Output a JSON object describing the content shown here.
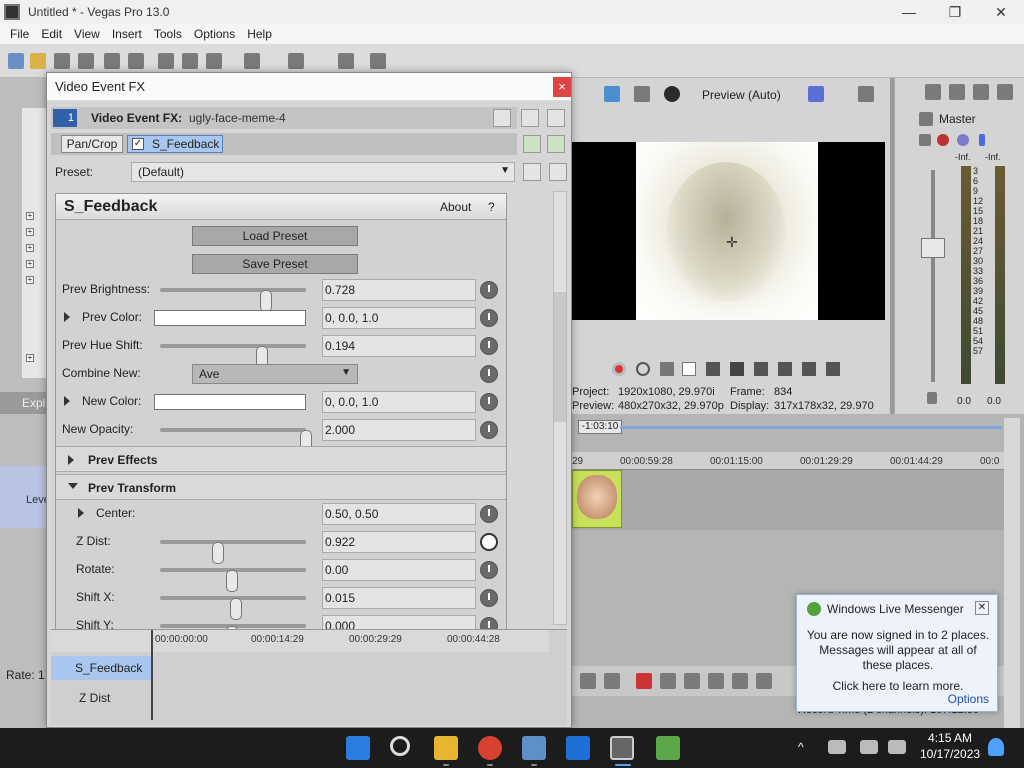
{
  "window": {
    "title": "Untitled * - Vegas Pro 13.0",
    "controls": {
      "minimize": "—",
      "maximize": "❐",
      "close": "✕"
    }
  },
  "menu": [
    "File",
    "Edit",
    "View",
    "Insert",
    "Tools",
    "Options",
    "Help"
  ],
  "left_panel": {
    "explorer_label": "Explo",
    "level_label": "Leve",
    "rate_label": "Rate: 1."
  },
  "dialog": {
    "title": "Video Event FX",
    "close": "×",
    "fx_number": "1",
    "fx_label": "Video Event FX:",
    "fx_event": "ugly-face-meme-4",
    "chain": {
      "item1": "Pan/Crop",
      "item2": "S_Feedback",
      "check": "✓"
    },
    "preset": {
      "label": "Preset:",
      "value": "(Default)"
    },
    "plugin": {
      "name": "S_Feedback",
      "about": "About",
      "help": "?",
      "load_preset": "Load Preset",
      "save_preset": "Save Preset",
      "params": [
        {
          "label": "Prev Brightness:",
          "value": "0.728",
          "slider": 0.72
        },
        {
          "label": "Prev Color:",
          "value": "0, 0.0, 1.0"
        },
        {
          "label": "Prev Hue Shift:",
          "value": "0.194",
          "slider": 0.7
        },
        {
          "label": "Combine New:",
          "value": "Ave"
        },
        {
          "label": "New Color:",
          "value": "0, 0.0, 1.0"
        },
        {
          "label": "New Opacity:",
          "value": "2.000",
          "slider": 1.0
        }
      ],
      "sections": {
        "prev_effects": "Prev Effects",
        "prev_transform": "Prev Transform"
      },
      "transform_params": [
        {
          "label": "Center:",
          "value": "0.50, 0.50"
        },
        {
          "label": "Z Dist:",
          "value": "0.922",
          "slider": 0.4
        },
        {
          "label": "Rotate:",
          "value": "0.00",
          "slider": 0.5
        },
        {
          "label": "Shift X:",
          "value": "0.015",
          "slider": 0.53
        },
        {
          "label": "Shift Y:",
          "value": "0.000",
          "slider": 0.5
        }
      ]
    },
    "keyframes": {
      "times": [
        "00:00:00:00",
        "00:00:14:29",
        "00:00:29:29",
        "00:00:44:28"
      ],
      "track_fx": "S_Feedback",
      "track_param": "Z Dist"
    }
  },
  "preview": {
    "mode": "Preview (Auto)",
    "project_label": "Project:",
    "project_value": "1920x1080, 29.970i",
    "frame_label": "Frame:",
    "frame_value": "834",
    "preview_label": "Preview:",
    "preview_value": "480x270x32, 29.970p",
    "display_label": "Display:",
    "display_value": "317x178x32, 29.970"
  },
  "mixer": {
    "title": "Master",
    "inf_left": "-Inf.",
    "inf_right": "-Inf.",
    "zero_left": "0.0",
    "zero_right": "0.0",
    "scale": [
      "3",
      "6",
      "9",
      "12",
      "15",
      "18",
      "21",
      "24",
      "27",
      "30",
      "33",
      "36",
      "39",
      "42",
      "45",
      "48",
      "51",
      "54",
      "57"
    ]
  },
  "timeline": {
    "position": "-1:03:10",
    "ruler": [
      "00:00:59:28",
      "00:01:15:00",
      "00:01:29:29",
      "00:01:44:29",
      "00:0"
    ],
    "ruler_left": "29",
    "record_time": "Record Time (2 channels): 167:12:30"
  },
  "notification": {
    "app": "Windows Live Messenger",
    "message": "You are now signed in to 2 places. Messages will appear at all of these places.",
    "link": "Click here to learn more.",
    "options": "Options"
  },
  "taskbar": {
    "time": "4:15 AM",
    "date": "10/17/2023"
  },
  "colors": {
    "accent": "#a9c7ee",
    "dialog_bg": "#d6d6d6",
    "taskbar_bg": "#1c1c1c",
    "clip": "#c7e15a"
  }
}
